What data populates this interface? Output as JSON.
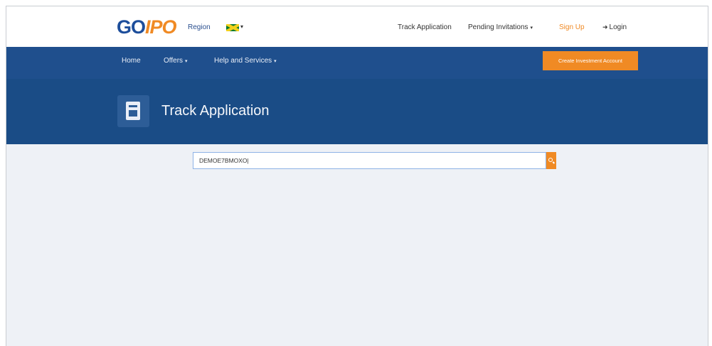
{
  "header": {
    "logo": {
      "go": "GO",
      "ipo": "IPO"
    },
    "region_label": "Region",
    "flag_icon": "jamaica-flag-icon",
    "links": {
      "track_application": "Track Application",
      "pending_invitations": "Pending Invitations",
      "sign_up": "Sign Up",
      "login": "Login"
    }
  },
  "nav": {
    "home": "Home",
    "offers": "Offers",
    "help": "Help and Services",
    "create_account": "Create Investment Account"
  },
  "hero": {
    "title": "Track Application",
    "icon": "document-icon"
  },
  "search": {
    "value": "DEMOE7BMOXO|",
    "icon": "search-icon"
  },
  "colors": {
    "brand_blue": "#1f4f8d",
    "hero_blue": "#1a4c86",
    "accent_orange": "#f08a24",
    "page_bg": "#eef1f6"
  }
}
